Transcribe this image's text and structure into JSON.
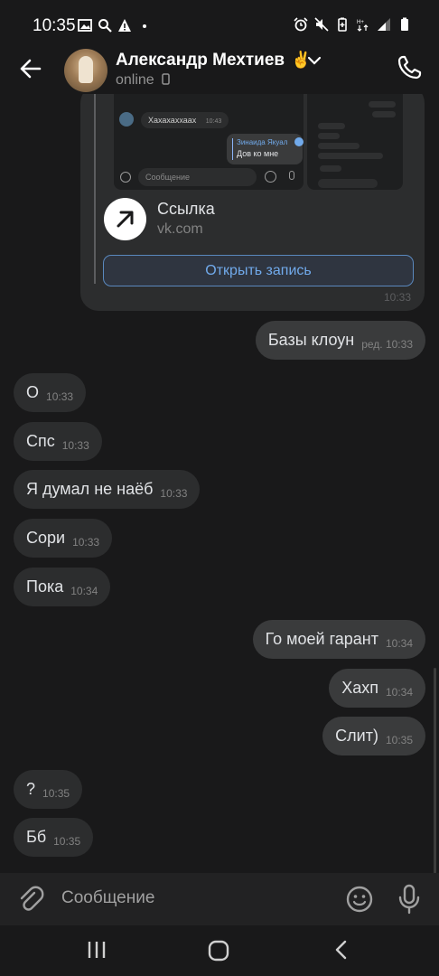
{
  "status_bar": {
    "time": "10:35",
    "left_icons": [
      "image-icon",
      "search-icon",
      "warning-icon",
      "dot-icon"
    ],
    "right_icons": [
      "alarm-icon",
      "mute-icon",
      "battery-saver-icon",
      "network-icon",
      "signal-icon",
      "battery-icon"
    ]
  },
  "header": {
    "contact_name": "Александр Мехтиев",
    "name_emoji": "✌",
    "status": "online"
  },
  "forwarded_card": {
    "thumb_messages": {
      "incoming_text": "Хахахаххаах",
      "incoming_time": "10:43",
      "reply_name": "Зинаида Якуал",
      "reply_text": "Дов ко мне",
      "input_placeholder": "Сообщение"
    },
    "link_title": "Ссылка",
    "link_domain": "vk.com",
    "open_button": "Открыть запись",
    "time": "10:33"
  },
  "messages": [
    {
      "dir": "out",
      "text": "Базы клоун",
      "time": "ред. 10:33"
    },
    {
      "dir": "in",
      "text": "О",
      "time": "10:33"
    },
    {
      "dir": "in",
      "text": "Спс",
      "time": "10:33"
    },
    {
      "dir": "in",
      "text": "Я думал не наёб",
      "time": "10:33"
    },
    {
      "dir": "in",
      "text": "Сори",
      "time": "10:33"
    },
    {
      "dir": "in",
      "text": "Пока",
      "time": "10:34"
    },
    {
      "dir": "out",
      "text": "Го моей гарант",
      "time": "10:34"
    },
    {
      "dir": "out",
      "text": "Хахп",
      "time": "10:34"
    },
    {
      "dir": "out",
      "text": "Слит)",
      "time": "10:35"
    },
    {
      "dir": "in",
      "text": "?",
      "time": "10:35"
    },
    {
      "dir": "in",
      "text": "Бб",
      "time": "10:35"
    }
  ],
  "composer": {
    "placeholder": "Сообщение"
  },
  "colors": {
    "background": "#19191a",
    "incoming_bubble": "#2c2d2e",
    "outgoing_bubble": "#3a3b3c",
    "accent": "#71aaeb"
  }
}
